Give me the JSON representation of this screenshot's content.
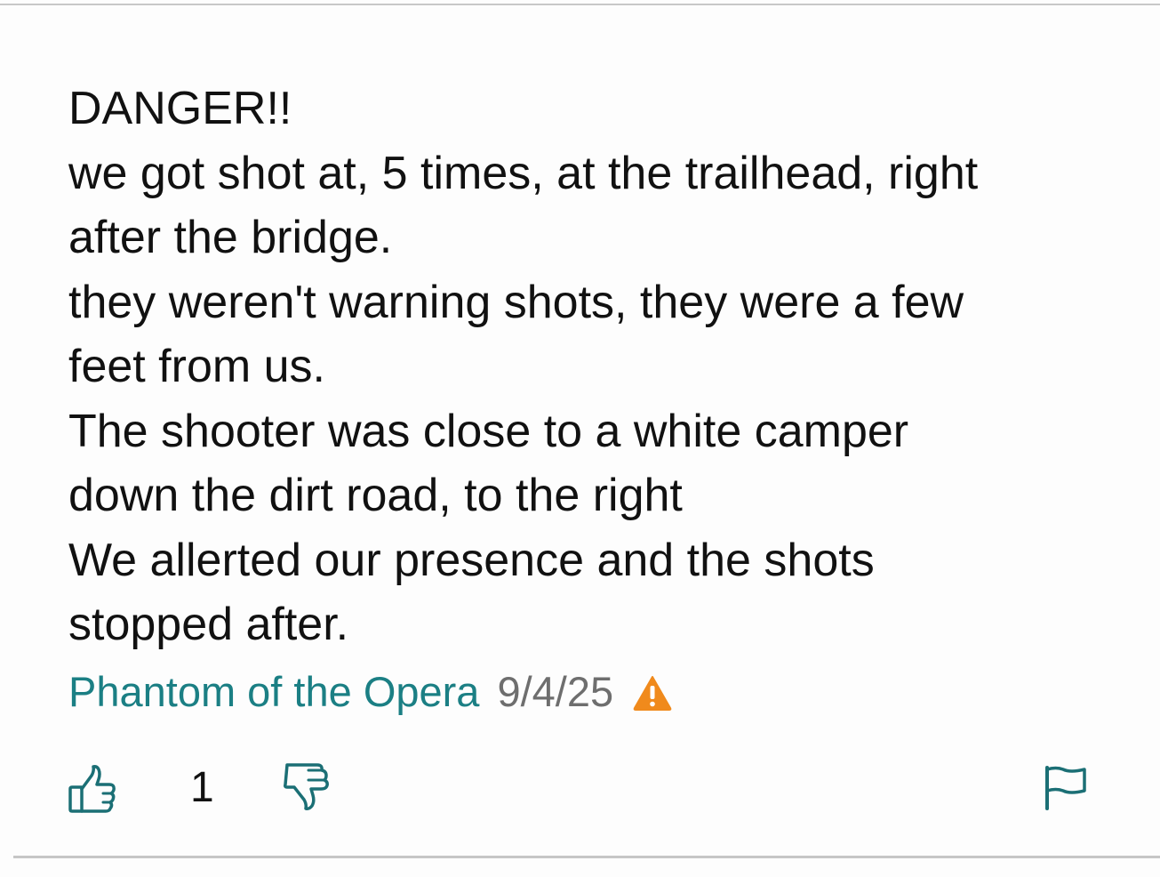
{
  "comment": {
    "lines": [
      "DANGER!!",
      "we got shot at, 5 times, at the trailhead, right",
      "after the bridge.",
      "they weren't warning shots, they were a few",
      "feet from us.",
      "The shooter was close to a white camper",
      "down the dirt road, to the right",
      "We allerted our presence and the shots",
      "stopped after."
    ],
    "author": "Phantom of the Opera",
    "date": "9/4/25",
    "warning_icon": "warning-triangle-icon"
  },
  "actions": {
    "upvote_icon": "thumbs-up-icon",
    "vote_count": "1",
    "downvote_icon": "thumbs-down-icon",
    "flag_icon": "flag-icon"
  },
  "colors": {
    "author": "#1b7f84",
    "date": "#6e6e6e",
    "icon": "#1b6f75",
    "warning": "#f08a1c",
    "text": "#111111"
  }
}
